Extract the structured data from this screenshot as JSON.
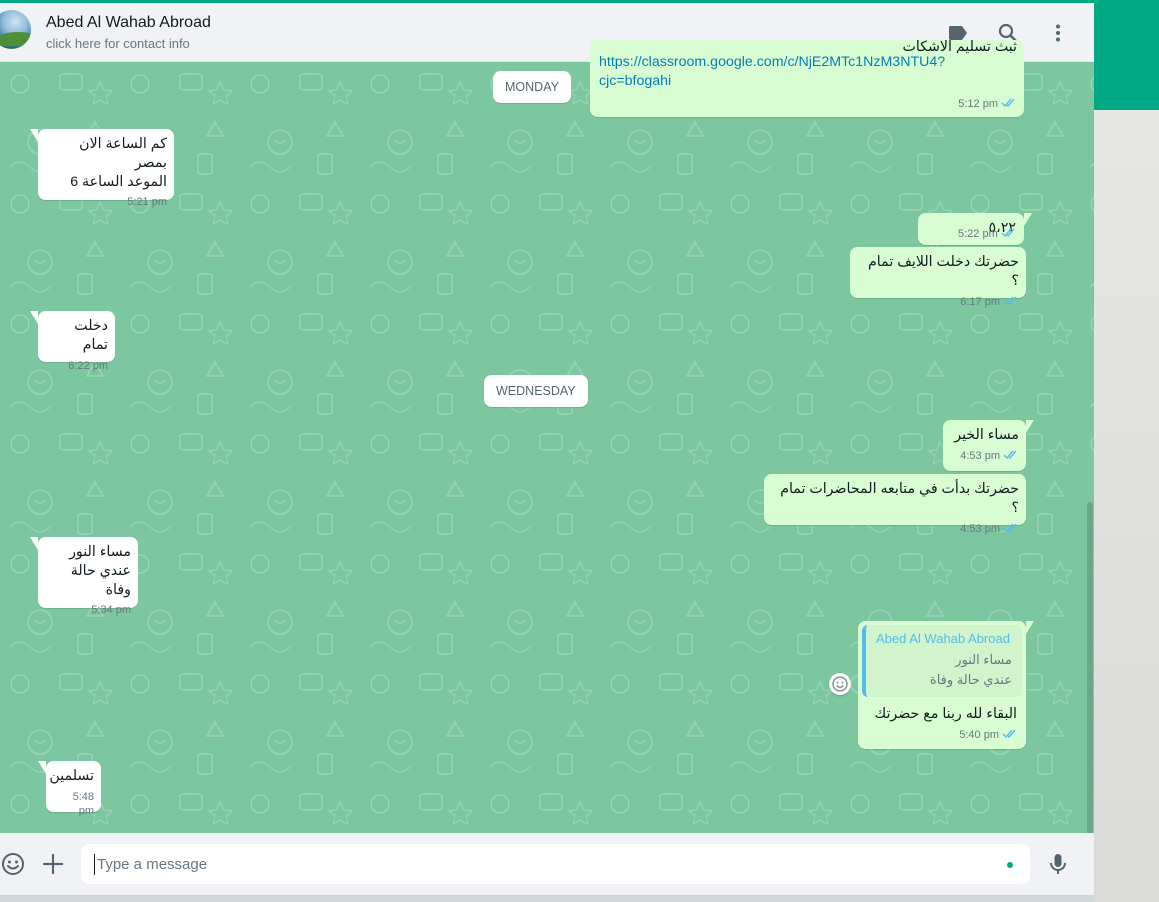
{
  "header": {
    "contact_name": "Abed Al Wahab Abroad",
    "contact_sub": "click here for contact info",
    "icons": [
      "label-icon",
      "search-icon",
      "menu-icon"
    ]
  },
  "messages": {
    "m0": {
      "text": "ثبث تسليم الاشكات",
      "link": "https://classroom.google.com/c/NjE2MTc1NzM3NTU4?cjc=bfogahi",
      "time": "5:12 pm"
    },
    "day1": "MONDAY",
    "m1": {
      "text": "كم الساعة الان بمصر\nالموعد الساعة 6",
      "time": "5:21 pm"
    },
    "m2": {
      "text": "٥،٢٢",
      "time": "5:22 pm"
    },
    "m3": {
      "text": "حضرتك دخلت اللايف تمام ؟",
      "time": "6:17 pm"
    },
    "m4": {
      "text": "دخلت تمام",
      "time": "6:22 pm"
    },
    "day2": "WEDNESDAY",
    "m5": {
      "text": "مساء الخير",
      "time": "4:53 pm"
    },
    "m6": {
      "text": "حضرتك بدأت في متابعه المحاضرات تمام ؟",
      "time": "4:53 pm"
    },
    "m7": {
      "text": "مساء النور\nعندي حالة وفاة",
      "time": "5:34 pm"
    },
    "m8": {
      "quote_author": "Abed Al Wahab Abroad",
      "quote_text": "مساء النور\nعندي حالة وفاة",
      "text": "البقاء لله ربنا مع حضرتك",
      "time": "5:40 pm"
    },
    "m9": {
      "text": "تسلمين",
      "time": "5:48 pm"
    }
  },
  "composer": {
    "placeholder": "Type a message",
    "icons": [
      "emoji-icon",
      "attach-icon",
      "mic-icon"
    ]
  },
  "colors": {
    "accent": "#00a884",
    "chat_bg": "#7cc7a0",
    "bubble_out": "#d9fdd3",
    "bubble_in": "#ffffff",
    "tick_read": "#53bdeb",
    "link": "#027eb5"
  }
}
